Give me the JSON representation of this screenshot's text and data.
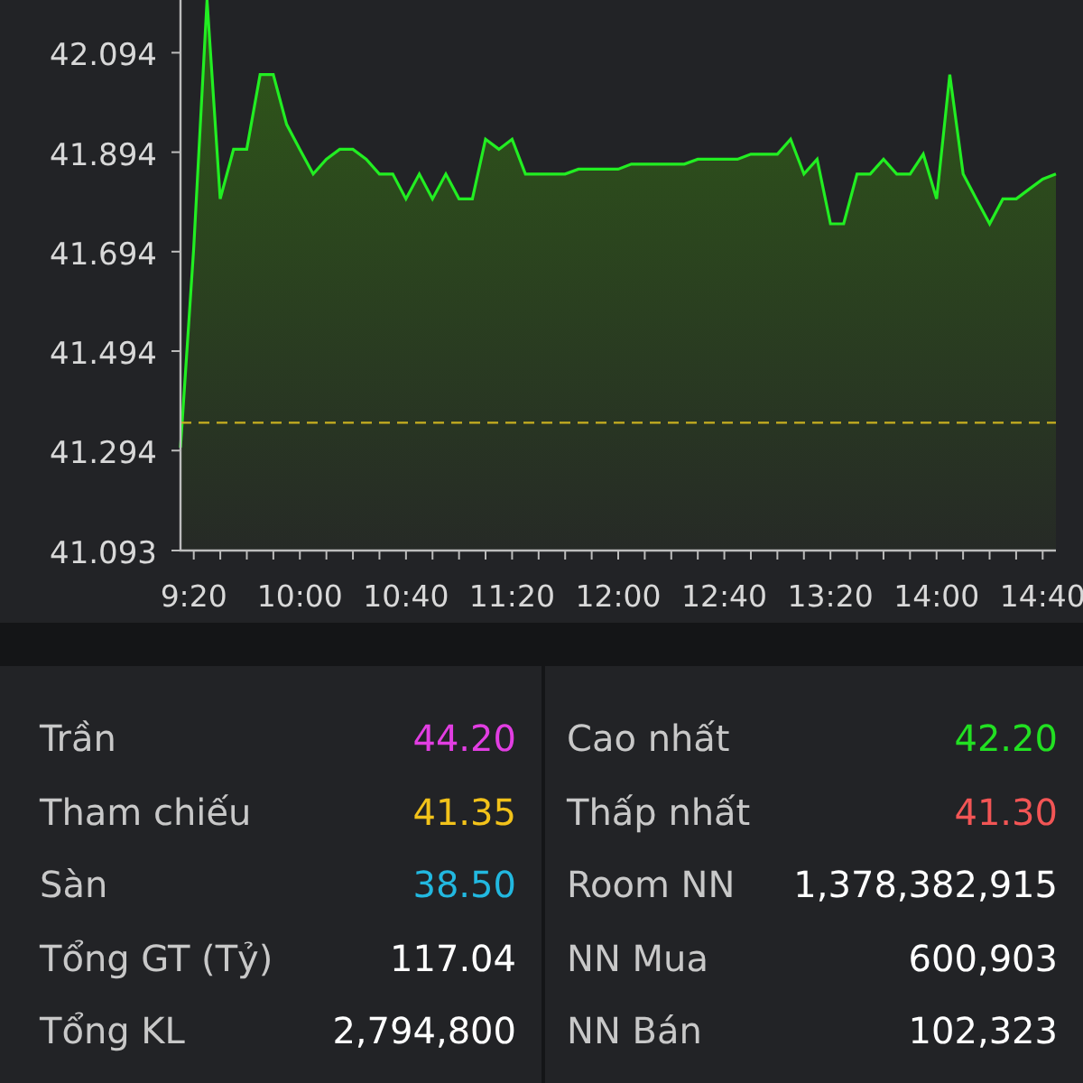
{
  "chart": {
    "chart_data": {
      "type": "area",
      "ylim": [
        41.093,
        42.2
      ],
      "yticks": [
        {
          "value": 41.093,
          "label": "41.093"
        },
        {
          "value": 41.294,
          "label": "41.294"
        },
        {
          "value": 41.494,
          "label": "41.494"
        },
        {
          "value": 41.694,
          "label": "41.694"
        },
        {
          "value": 41.894,
          "label": "41.894"
        },
        {
          "value": 42.094,
          "label": "42.094"
        }
      ],
      "categories": [
        null,
        "9:20",
        null,
        null,
        null,
        null,
        null,
        null,
        null,
        "10:00",
        null,
        null,
        null,
        null,
        null,
        null,
        null,
        "10:40",
        null,
        null,
        null,
        null,
        null,
        null,
        null,
        "11:20",
        null,
        null,
        null,
        null,
        null,
        null,
        null,
        "12:00",
        null,
        null,
        null,
        null,
        null,
        null,
        null,
        "12:40",
        null,
        null,
        null,
        null,
        null,
        null,
        null,
        "13:20",
        null,
        null,
        null,
        null,
        null,
        null,
        null,
        "14:00",
        null,
        null,
        null,
        null,
        null,
        null,
        null,
        "14:40",
        null
      ],
      "series": [
        {
          "color": "#22ee22",
          "values": [
            41.3,
            41.7,
            42.2,
            41.8,
            41.9,
            41.9,
            42.05,
            42.05,
            41.95,
            41.9,
            41.85,
            41.88,
            41.9,
            41.9,
            41.88,
            41.85,
            41.85,
            41.8,
            41.85,
            41.8,
            41.85,
            41.8,
            41.8,
            41.92,
            41.9,
            41.92,
            41.85,
            41.85,
            41.85,
            41.85,
            41.86,
            41.86,
            41.86,
            41.86,
            41.87,
            41.87,
            41.87,
            41.87,
            41.87,
            41.88,
            41.88,
            41.88,
            41.88,
            41.89,
            41.89,
            41.89,
            41.92,
            41.85,
            41.88,
            41.75,
            41.75,
            41.85,
            41.85,
            41.88,
            41.85,
            41.85,
            41.89,
            41.8,
            42.05,
            41.85,
            41.8,
            41.75,
            41.8,
            41.8,
            41.82,
            41.84,
            41.85
          ]
        }
      ],
      "ref_lines": [
        {
          "axis": "y",
          "value": 41.35,
          "color": "#c8b020"
        }
      ]
    }
  },
  "stats": {
    "left": [
      {
        "label": "Trần",
        "value": "44.20",
        "color": "#e23ee2"
      },
      {
        "label": "Tham chiếu",
        "value": "41.35",
        "color": "#f2c21a"
      },
      {
        "label": "Sàn",
        "value": "38.50",
        "color": "#22b8e0"
      },
      {
        "label": "Tổng GT (Tỷ)",
        "value": "117.04",
        "color": "#ffffff"
      },
      {
        "label": "Tổng KL",
        "value": "2,794,800",
        "color": "#ffffff"
      }
    ],
    "right": [
      {
        "label": "Cao nhất",
        "value": "42.20",
        "color": "#22e022"
      },
      {
        "label": "Thấp nhất",
        "value": "41.30",
        "color": "#f25555"
      },
      {
        "label": "Room NN",
        "value": "1,378,382,915",
        "color": "#ffffff"
      },
      {
        "label": "NN Mua",
        "value": "600,903",
        "color": "#ffffff"
      },
      {
        "label": "NN Bán",
        "value": "102,323",
        "color": "#ffffff"
      }
    ]
  }
}
